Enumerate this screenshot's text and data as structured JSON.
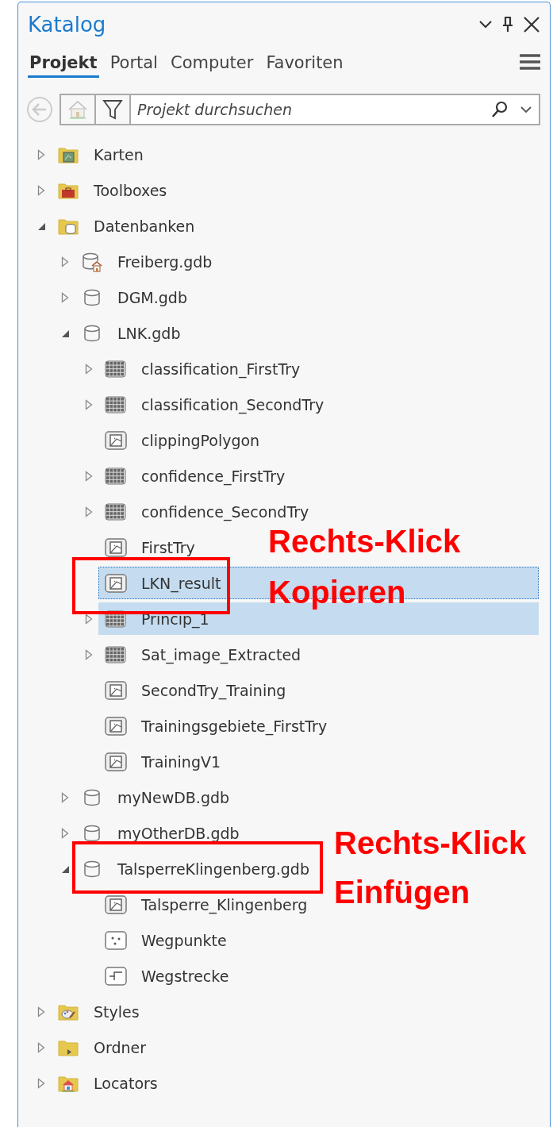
{
  "panel": {
    "title": "Katalog"
  },
  "tabs": [
    {
      "label": "Projekt",
      "selected": true
    },
    {
      "label": "Portal",
      "selected": false
    },
    {
      "label": "Computer",
      "selected": false
    },
    {
      "label": "Favoriten",
      "selected": false
    }
  ],
  "search": {
    "placeholder": "Projekt durchsuchen"
  },
  "tree": [
    {
      "label": "Karten",
      "kind": "folder-map",
      "expanded": false,
      "selected": false,
      "hovered": false
    },
    {
      "label": "Toolboxes",
      "kind": "folder-toolbox",
      "expanded": false,
      "selected": false,
      "hovered": false
    },
    {
      "label": "Datenbanken",
      "kind": "folder-db",
      "expanded": true,
      "selected": false,
      "hovered": false,
      "children": [
        {
          "label": "Freiberg.gdb",
          "kind": "gdb-home",
          "expanded": false,
          "selected": false,
          "hovered": false
        },
        {
          "label": "DGM.gdb",
          "kind": "gdb",
          "expanded": false,
          "selected": false,
          "hovered": false
        },
        {
          "label": "LNK.gdb",
          "kind": "gdb",
          "expanded": true,
          "selected": false,
          "hovered": false,
          "children": [
            {
              "label": "classification_FirstTry",
              "kind": "raster",
              "expanded": false,
              "selected": false,
              "hovered": false
            },
            {
              "label": "classification_SecondTry",
              "kind": "raster",
              "expanded": false,
              "selected": false,
              "hovered": false
            },
            {
              "label": "clippingPolygon",
              "kind": "polygon",
              "selected": false,
              "hovered": false
            },
            {
              "label": "confidence_FirstTry",
              "kind": "raster",
              "expanded": false,
              "selected": false,
              "hovered": false
            },
            {
              "label": "confidence_SecondTry",
              "kind": "raster",
              "expanded": false,
              "selected": false,
              "hovered": false
            },
            {
              "label": "FirstTry",
              "kind": "polygon",
              "selected": false,
              "hovered": false
            },
            {
              "label": "LKN_result",
              "kind": "polygon",
              "selected": true,
              "hovered": false
            },
            {
              "label": "Princip_1",
              "kind": "raster",
              "expanded": false,
              "selected": false,
              "hovered": true
            },
            {
              "label": "Sat_image_Extracted",
              "kind": "raster",
              "expanded": false,
              "selected": false,
              "hovered": false
            },
            {
              "label": "SecondTry_Training",
              "kind": "polygon",
              "selected": false,
              "hovered": false
            },
            {
              "label": "Trainingsgebiete_FirstTry",
              "kind": "polygon",
              "selected": false,
              "hovered": false
            },
            {
              "label": "TrainingV1",
              "kind": "polygon",
              "selected": false,
              "hovered": false
            }
          ]
        },
        {
          "label": "myNewDB.gdb",
          "kind": "gdb",
          "expanded": false,
          "selected": false,
          "hovered": false
        },
        {
          "label": "myOtherDB.gdb",
          "kind": "gdb",
          "expanded": false,
          "selected": false,
          "hovered": false
        },
        {
          "label": "TalsperreKlingenberg.gdb",
          "kind": "gdb",
          "expanded": true,
          "selected": false,
          "hovered": false,
          "children": [
            {
              "label": "Talsperre_Klingenberg",
              "kind": "polygon",
              "selected": false,
              "hovered": false
            },
            {
              "label": "Wegpunkte",
              "kind": "points",
              "selected": false,
              "hovered": false
            },
            {
              "label": "Wegstrecke",
              "kind": "line",
              "selected": false,
              "hovered": false
            }
          ]
        }
      ]
    },
    {
      "label": "Styles",
      "kind": "folder-styles",
      "expanded": false,
      "selected": false,
      "hovered": false
    },
    {
      "label": "Ordner",
      "kind": "folder",
      "expanded": false,
      "selected": false,
      "hovered": false
    },
    {
      "label": "Locators",
      "kind": "folder-locator",
      "expanded": false,
      "selected": false,
      "hovered": false
    }
  ],
  "annotations": [
    {
      "lines": [
        "Rechts-Klick",
        "Kopieren"
      ]
    },
    {
      "lines": [
        "Rechts-Klick",
        "Einfügen"
      ]
    }
  ]
}
